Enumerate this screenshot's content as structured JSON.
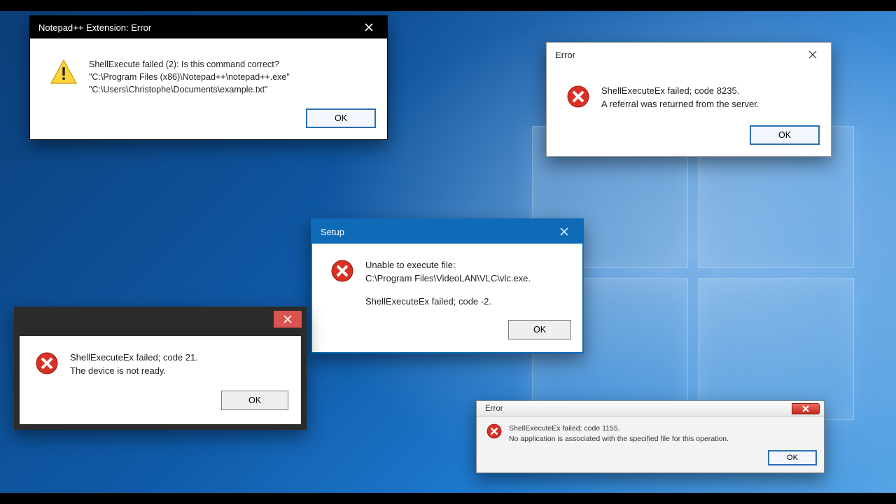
{
  "dlg1": {
    "title": "Notepad++ Extension: Error",
    "line1": "ShellExecute failed (2): Is this command correct?",
    "line2": "\"C:\\Program Files (x86)\\Notepad++\\notepad++.exe\"",
    "line3": "\"C:\\Users\\Christophe\\Documents\\example.txt\"",
    "ok": "OK"
  },
  "dlg2": {
    "title": "Error",
    "line1": "ShellExecuteEx failed; code 8235.",
    "line2": "A referral was returned from the server.",
    "ok": "OK"
  },
  "dlg3": {
    "title": "Setup",
    "line1": "Unable to execute file:",
    "line2": "C:\\Program Files\\VideoLAN\\VLC\\vlc.exe.",
    "line3": "ShellExecuteEx failed; code -2.",
    "ok": "OK"
  },
  "dlg4": {
    "title": "",
    "line1": "ShellExecuteEx failed; code 21.",
    "line2": "The device is not ready.",
    "ok": "OK"
  },
  "dlg5": {
    "title": "Error",
    "line1": "ShellExecuteEx failed; code 1155.",
    "line2": "No application is associated with the specified file for this operation.",
    "ok": "OK"
  }
}
